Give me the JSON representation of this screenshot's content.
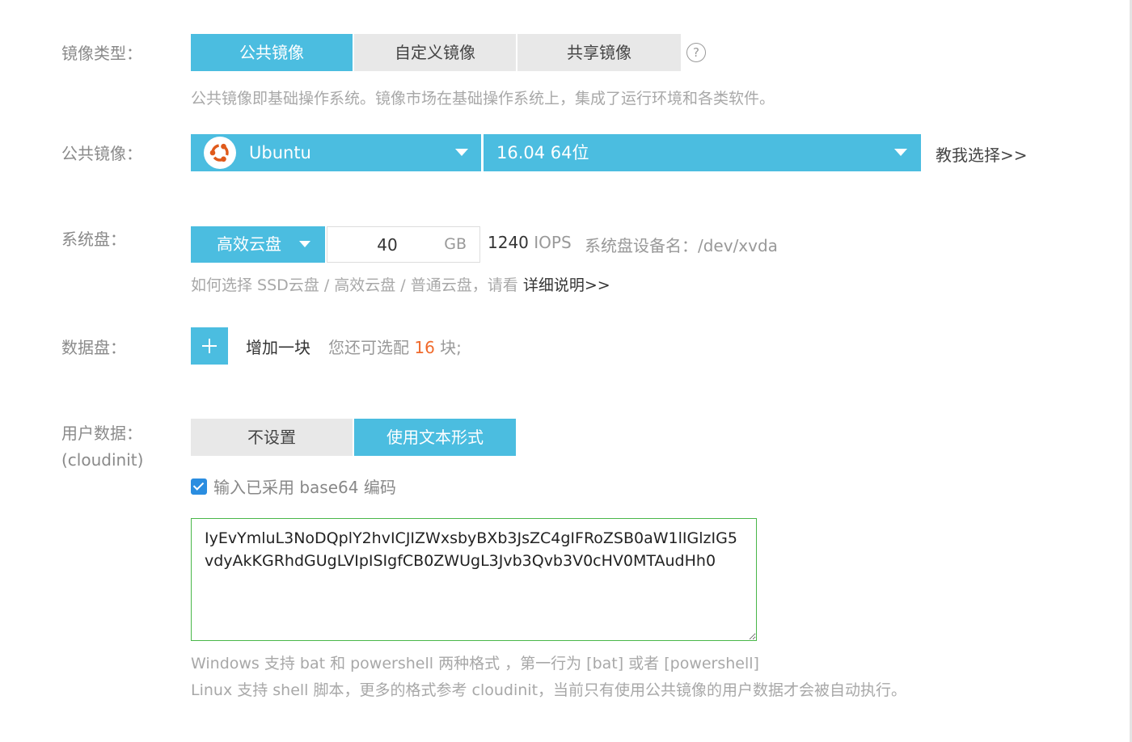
{
  "image_type": {
    "label": "镜像类型：",
    "tabs": [
      "公共镜像",
      "自定义镜像",
      "共享镜像"
    ],
    "help_icon": "question-circle-icon",
    "hint": "公共镜像即基础操作系统。镜像市场在基础操作系统上，集成了运行环境和各类软件。"
  },
  "public_image": {
    "label": "公共镜像：",
    "os_icon": "ubuntu-logo-icon",
    "os": "Ubuntu",
    "version": "16.04 64位",
    "help_link": "教我选择>>"
  },
  "system_disk": {
    "label": "系统盘：",
    "type": "高效云盘",
    "size": "40",
    "unit": "GB",
    "iops_value": "1240",
    "iops_unit": "IOPS",
    "device_label": "系统盘设备名：/dev/xvda",
    "hint_prefix": "如何选择 SSD云盘 / 高效云盘 / 普通云盘，请看",
    "hint_link": "详细说明>>"
  },
  "data_disk": {
    "label": "数据盘：",
    "add_label": "增加一块",
    "quota_prefix": "您还可选配",
    "quota_count": "16",
    "quota_suffix": "块;"
  },
  "user_data": {
    "label": "用户数据：",
    "label_sub": "(cloudinit)",
    "tabs": [
      "不设置",
      "使用文本形式"
    ],
    "checkbox_label": "输入已采用 base64 编码",
    "checkbox_checked": true,
    "text_value": "IyEvYmluL3NoDQplY2hvICJIZWxsbyBXb3JsZC4gIFRoZSB0aW1lIGlzIG5vdyAkKGRhdGUgLVIpISIgfCB0ZWUgL3Jvb3Qvb3V0cHV0MTAudHh0",
    "hint1": "Windows 支持 bat 和 powershell 两种格式 ，第一行为 [bat] 或者 [powershell]",
    "hint2": "Linux 支持 shell 脚本，更多的格式参考 cloudinit，当前只有使用公共镜像的用户数据才会被自动执行。"
  },
  "colors": {
    "accent": "#4bbde0",
    "inactive": "#e8e8e8",
    "highlight": "#f06a2c",
    "textarea_border": "#49b749",
    "checkbox": "#2a8de0"
  }
}
